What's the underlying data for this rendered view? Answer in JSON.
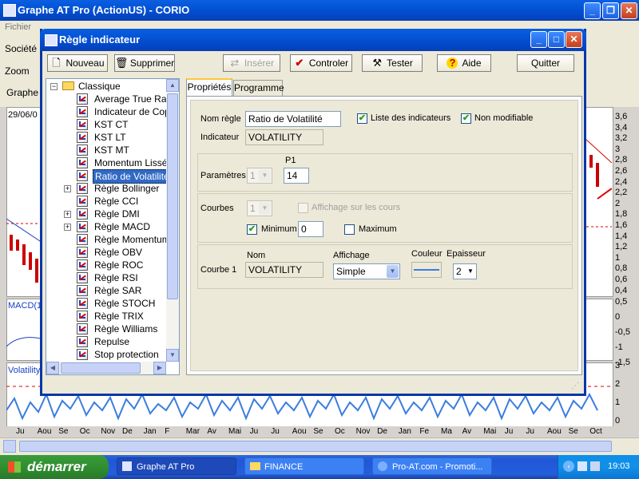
{
  "main_window": {
    "title": "Graphe AT Pro (ActionUS) - CORIO",
    "menu": [
      "Fichier"
    ],
    "toolbar_labels": {
      "societe": "Société",
      "zoom": "Zoom",
      "graphe": "Graphe"
    },
    "date_label": "29/06/0",
    "macd_label": "MACD(1",
    "volatility_label": "Volatility",
    "right_axis_top": [
      "3,6",
      "3,4",
      "3,2",
      "3",
      "2,8",
      "2,6",
      "2,4",
      "2,2",
      "2",
      "1,8",
      "1,6",
      "1,4",
      "1,2",
      "1",
      "0,8",
      "0,6",
      "0,4"
    ],
    "right_axis_mid": [
      "0,5",
      "0",
      "-0,5",
      "-1",
      "-1,5"
    ],
    "right_axis_bottom": [
      "3",
      "2",
      "1",
      "0"
    ],
    "months": [
      "Ju",
      "Aou",
      "Se",
      "Oc",
      "Nov",
      "De",
      "Jan",
      "F",
      "Mar",
      "Av",
      "Mai",
      "Ju",
      "Ju",
      "Aou",
      "Se",
      "Oc",
      "Nov",
      "De",
      "Jan",
      "Fe",
      "Ma",
      "Av",
      "Mai",
      "Ju",
      "Ju",
      "Aou",
      "Se",
      "Oct"
    ]
  },
  "dialog": {
    "title": "Règle indicateur",
    "toolbar": {
      "nouveau": "Nouveau",
      "supprimer": "Supprimer",
      "inserer": "Insérer",
      "controler": "Controler",
      "tester": "Tester",
      "aide": "Aide",
      "quitter": "Quitter"
    },
    "tree": {
      "root": "Classique",
      "items": [
        "Average True Rang",
        "Indicateur de Copp",
        "KST CT",
        "KST LT",
        "KST MT",
        "Momentum Lissé",
        "Ratio de Volatilité",
        "Règle Bollinger",
        "Règle CCI",
        "Règle DMI",
        "Règle MACD",
        "Règle Momentum",
        "Règle OBV",
        "Règle ROC",
        "Règle RSI",
        "Règle SAR",
        "Règle STOCH",
        "Règle TRIX",
        "Règle Williams",
        "Repulse",
        "Stop protection"
      ]
    },
    "tabs": {
      "proprietes": "Propriétés",
      "programme": "Programme"
    },
    "form": {
      "nom_regle_label": "Nom règle",
      "nom_regle_value": "Ratio de Volatilité",
      "liste_indicateurs_label": "Liste des indicateurs",
      "non_modifiable_label": "Non modifiable",
      "indicateur_label": "Indicateur",
      "indicateur_value": "VOLATILITY",
      "parametres_label": "Paramètres",
      "parametres_count": "1",
      "p1_label": "P1",
      "p1_value": "14",
      "courbes_label": "Courbes",
      "courbes_count": "1",
      "affichage_cours_label": "Affichage sur les cours",
      "minimum_label": "Minimum",
      "minimum_value": "0",
      "maximum_label": "Maximum",
      "courbe1_label": "Courbe 1",
      "nom_header": "Nom",
      "affichage_header": "Affichage",
      "couleur_header": "Couleur",
      "epaisseur_header": "Epaisseur",
      "courbe1_nom": "VOLATILITY",
      "courbe1_affichage": "Simple",
      "courbe1_epaisseur": "2"
    }
  },
  "taskbar": {
    "start": "démarrer",
    "items": [
      "Graphe AT Pro",
      "FINANCE",
      "Pro-AT.com - Promoti..."
    ],
    "clock": "19:03"
  }
}
